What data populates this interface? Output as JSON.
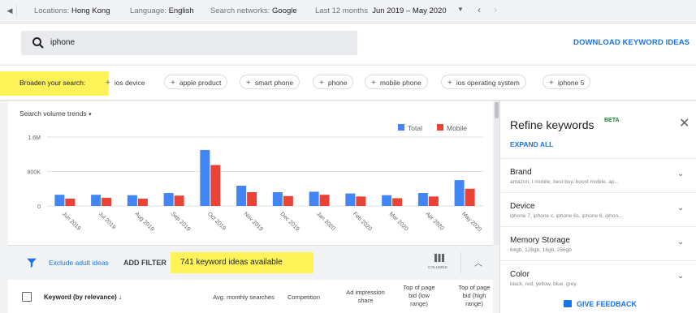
{
  "topbar": {
    "location_label": "Locations:",
    "location_value": "Hong Kong",
    "language_label": "Language:",
    "language_value": "English",
    "networks_label": "Search networks:",
    "networks_value": "Google",
    "period_label": "Last 12 months",
    "period_value": "Jun 2019 – May 2020"
  },
  "search": {
    "query": "iphone",
    "download_label": "DOWNLOAD KEYWORD IDEAS"
  },
  "broaden": {
    "label": "Broaden your search:",
    "chips": [
      "ios device",
      "apple product",
      "smart phone",
      "phone",
      "mobile phone",
      "ios operating system",
      "iphone 5"
    ]
  },
  "chart_data": {
    "type": "bar",
    "title": "Search volume trends",
    "categories": [
      "Jun 2019",
      "Jul 2019",
      "Aug 2019",
      "Sep 2019",
      "Oct 2019",
      "Nov 2019",
      "Dec 2019",
      "Jan 2020",
      "Feb 2020",
      "Mar 2020",
      "Apr 2020",
      "May 2020"
    ],
    "series": [
      {
        "name": "Total",
        "color": "#4285f4",
        "values": [
          260000,
          260000,
          250000,
          300000,
          1300000,
          470000,
          320000,
          330000,
          290000,
          250000,
          300000,
          600000
        ]
      },
      {
        "name": "Mobile",
        "color": "#ea4335",
        "values": [
          170000,
          190000,
          170000,
          240000,
          950000,
          320000,
          230000,
          260000,
          220000,
          180000,
          220000,
          400000
        ]
      }
    ],
    "yticks": [
      "0",
      "800K",
      "1.6M"
    ],
    "ylim": [
      0,
      1600000
    ],
    "legend": "top-right",
    "grid": true
  },
  "refine": {
    "title": "Refine keywords",
    "beta": "BETA",
    "expand_all": "EXPAND ALL",
    "sections": [
      {
        "name": "Brand",
        "sub": "amazon, t mobile, best buy, boost mobile, ap..."
      },
      {
        "name": "Device",
        "sub": "iphone 7, iphone x, iphone 6s, iphone 6, iphon..."
      },
      {
        "name": "Memory Storage",
        "sub": "64gb, 128gb, 16gb, 256gb"
      },
      {
        "name": "Color",
        "sub": "black, red, yellow, blue, grey"
      }
    ],
    "feedback": "GIVE FEEDBACK"
  },
  "filters": {
    "exclude_adult": "Exclude adult ideas",
    "add_filter": "ADD FILTER",
    "available": "741 keyword ideas available",
    "columns": "COLUMNS"
  },
  "table": {
    "headers": [
      "Keyword (by relevance)",
      "Avg. monthly searches",
      "Competition",
      "Ad impression share",
      "Top of page bid (low range)",
      "Top of page bid (high range)"
    ]
  }
}
